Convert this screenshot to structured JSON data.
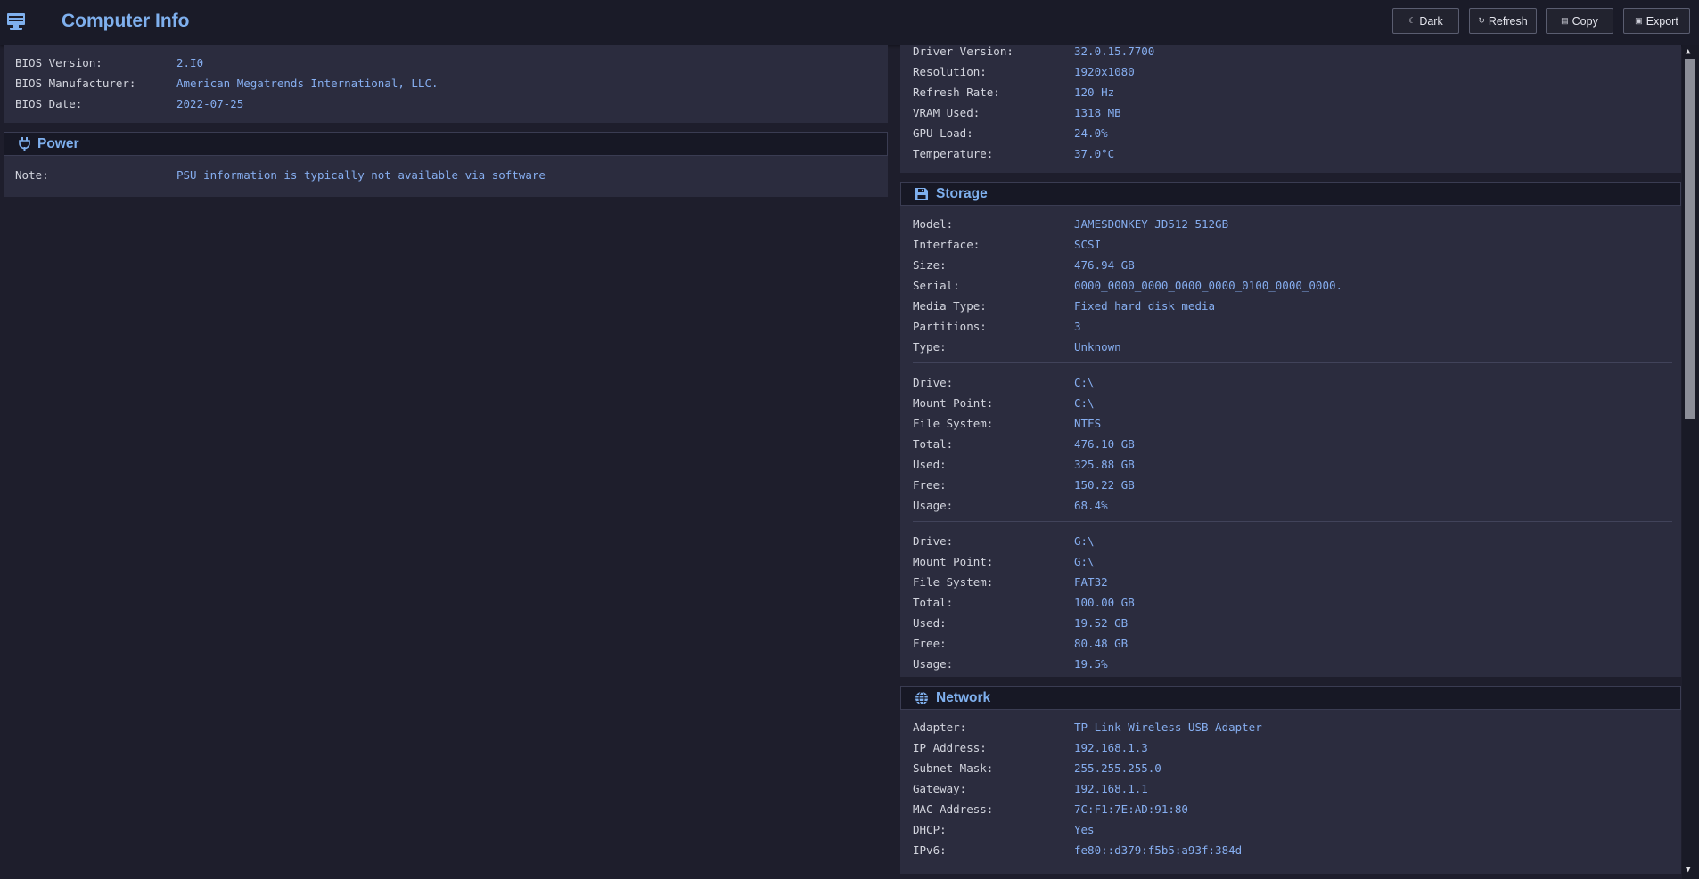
{
  "header": {
    "title": "Computer Info",
    "buttons": {
      "dark": "Dark",
      "refresh": "Refresh",
      "copy": "Copy",
      "export": "Export"
    }
  },
  "bios": {
    "rows": [
      {
        "k": "BIOS Version:",
        "v": "2.I0"
      },
      {
        "k": "BIOS Manufacturer:",
        "v": "American Megatrends International, LLC."
      },
      {
        "k": "BIOS Date:",
        "v": "2022-07-25"
      }
    ]
  },
  "power": {
    "title": "Power",
    "rows": [
      {
        "k": "Note:",
        "v": "PSU information is typically not available via software"
      }
    ]
  },
  "gpu": {
    "rows": [
      {
        "k": "Driver Version:",
        "v": "32.0.15.7700"
      },
      {
        "k": "Resolution:",
        "v": "1920x1080"
      },
      {
        "k": "Refresh Rate:",
        "v": "120 Hz"
      },
      {
        "k": "VRAM Used:",
        "v": "1318 MB"
      },
      {
        "k": "GPU Load:",
        "v": "24.0%"
      },
      {
        "k": "Temperature:",
        "v": "37.0°C"
      }
    ]
  },
  "storage": {
    "title": "Storage",
    "disk": [
      {
        "k": "Model:",
        "v": "JAMESDONKEY JD512 512GB"
      },
      {
        "k": "Interface:",
        "v": "SCSI"
      },
      {
        "k": "Size:",
        "v": "476.94 GB"
      },
      {
        "k": "Serial:",
        "v": "0000_0000_0000_0000_0000_0100_0000_0000."
      },
      {
        "k": "Media Type:",
        "v": "Fixed hard disk media"
      },
      {
        "k": "Partitions:",
        "v": "3"
      },
      {
        "k": "Type:",
        "v": "Unknown"
      }
    ],
    "drive_c": [
      {
        "k": "Drive:",
        "v": "C:\\"
      },
      {
        "k": "Mount Point:",
        "v": "C:\\"
      },
      {
        "k": "File System:",
        "v": "NTFS"
      },
      {
        "k": "Total:",
        "v": "476.10 GB"
      },
      {
        "k": "Used:",
        "v": "325.88 GB"
      },
      {
        "k": "Free:",
        "v": "150.22 GB"
      },
      {
        "k": "Usage:",
        "v": "68.4%"
      }
    ],
    "drive_g": [
      {
        "k": "Drive:",
        "v": "G:\\"
      },
      {
        "k": "Mount Point:",
        "v": "G:\\"
      },
      {
        "k": "File System:",
        "v": "FAT32"
      },
      {
        "k": "Total:",
        "v": "100.00 GB"
      },
      {
        "k": "Used:",
        "v": "19.52 GB"
      },
      {
        "k": "Free:",
        "v": "80.48 GB"
      },
      {
        "k": "Usage:",
        "v": "19.5%"
      }
    ]
  },
  "network": {
    "title": "Network",
    "rows": [
      {
        "k": "Adapter:",
        "v": "TP-Link Wireless USB Adapter"
      },
      {
        "k": "IP Address:",
        "v": "192.168.1.3"
      },
      {
        "k": "Subnet Mask:",
        "v": "255.255.255.0"
      },
      {
        "k": "Gateway:",
        "v": "192.168.1.1"
      },
      {
        "k": "MAC Address:",
        "v": "7C:F1:7E:AD:91:80"
      },
      {
        "k": "DHCP:",
        "v": "Yes"
      },
      {
        "k": "IPv6:",
        "v": "fe80::d379:f5b5:a93f:384d"
      }
    ]
  },
  "colors": {
    "accent": "#7fb0ee",
    "value": "#86aef0",
    "background": "#1e1e2c",
    "card": "#2b2c3e"
  },
  "icons": {
    "app": "computer-icon",
    "power": "plug-icon",
    "storage": "floppy-disk-icon",
    "network": "globe-icon"
  }
}
